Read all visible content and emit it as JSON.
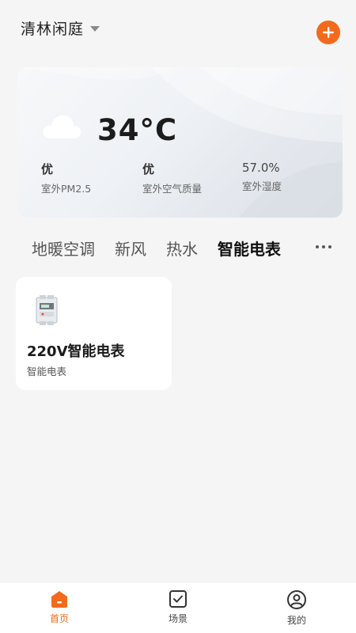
{
  "header": {
    "home_name": "清林闲庭",
    "add_icon": "plus-icon",
    "accent_color": "#f26a1b"
  },
  "weather": {
    "temperature": "34°C",
    "icon": "cloud-icon",
    "metrics": [
      {
        "value": "优",
        "label": "室外PM2.5"
      },
      {
        "value": "优",
        "label": "室外空气质量"
      },
      {
        "value": "57.0%",
        "label": "室外湿度"
      }
    ]
  },
  "tabs": [
    {
      "label": "地暖空调",
      "active": false
    },
    {
      "label": "新风",
      "active": false
    },
    {
      "label": "热水",
      "active": false
    },
    {
      "label": "智能电表",
      "active": true
    }
  ],
  "devices": [
    {
      "name": "220V智能电表",
      "type": "智能电表",
      "icon": "electric-meter-icon"
    }
  ],
  "bottom_nav": [
    {
      "label": "首页",
      "icon": "home-icon",
      "active": true
    },
    {
      "label": "场景",
      "icon": "scene-checkbox-icon",
      "active": false
    },
    {
      "label": "我的",
      "icon": "profile-icon",
      "active": false
    }
  ]
}
